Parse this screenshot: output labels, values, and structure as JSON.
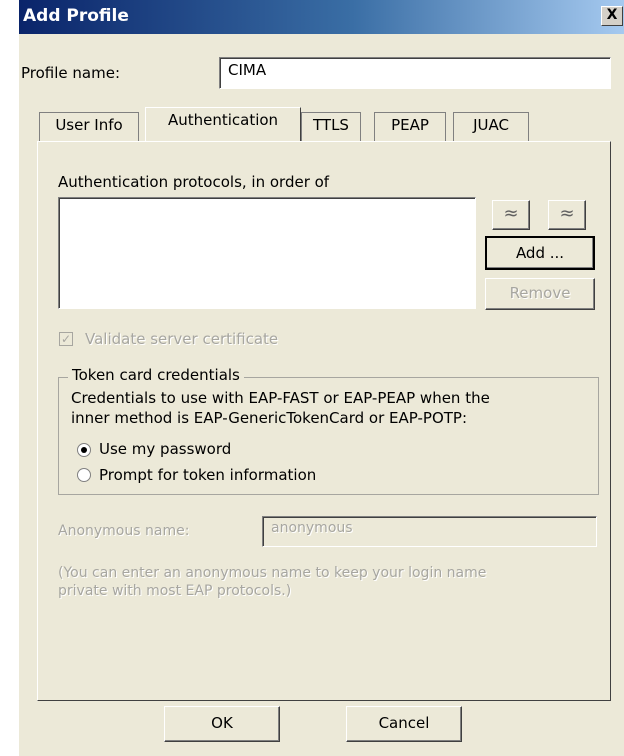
{
  "window": {
    "title": "Add Profile",
    "close_glyph": "X"
  },
  "profile": {
    "label": "Profile name:",
    "value": "CIMA"
  },
  "tabs": [
    {
      "label": "User Info"
    },
    {
      "label": "Authentication"
    },
    {
      "label": "TTLS"
    },
    {
      "label": "PEAP"
    },
    {
      "label": "JUAC"
    }
  ],
  "auth": {
    "protocols_label": "Authentication protocols, in order of",
    "move_up_glyph": "≈",
    "move_down_glyph": "≈",
    "add_label": "Add ...",
    "remove_label": "Remove",
    "validate_label": "Validate server certificate",
    "validate_checked": true
  },
  "token": {
    "group_title": "Token card credentials",
    "description_line1": "Credentials to use with EAP-FAST or EAP-PEAP when the",
    "description_line2": "inner method is EAP-GenericTokenCard or EAP-POTP:",
    "option1": "Use my password",
    "option2": "Prompt for token information",
    "selected": "option1"
  },
  "anonymous": {
    "label": "Anonymous name:",
    "value": "anonymous",
    "hint_line1": "(You can enter an anonymous name to keep your login name",
    "hint_line2": "private with most EAP protocols.)"
  },
  "footer": {
    "ok_label": "OK",
    "cancel_label": "Cancel"
  }
}
